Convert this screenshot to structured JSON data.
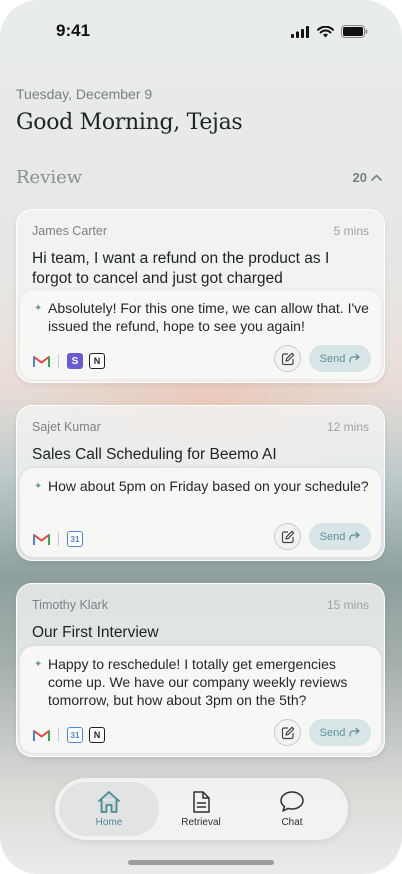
{
  "status": {
    "time": "9:41"
  },
  "header": {
    "date": "Tuesday, December 9",
    "greeting": "Good Morning, Tejas"
  },
  "review": {
    "title": "Review",
    "count": "20"
  },
  "cards": [
    {
      "sender": "James Carter",
      "time_ago": "5 mins",
      "subject": "Hi team, I want a refund on the product as I forgot to cancel and just got charged",
      "reply": "Absolutely! For this one time, we can allow that. I've issued the refund, hope to see you again!",
      "apps": [
        "gmail-icon",
        "stripe-icon",
        "notion-icon"
      ],
      "send_label": "Send"
    },
    {
      "sender": "Sajet Kumar",
      "time_ago": "12 mins",
      "subject": "Sales Call Scheduling for Beemo AI",
      "reply": "How about 5pm on Friday based on your schedule?",
      "apps": [
        "gmail-icon",
        "google-calendar-icon"
      ],
      "send_label": "Send"
    },
    {
      "sender": "Timothy Klark",
      "time_ago": "15 mins",
      "subject": "Our First Interview",
      "reply": "Happy to reschedule! I totally get emergencies come up. We have our company weekly reviews tomorrow, but how about 3pm on the 5th?",
      "apps": [
        "gmail-icon",
        "google-calendar-icon",
        "notion-icon"
      ],
      "send_label": "Send"
    }
  ],
  "tabs": [
    {
      "label": "Home",
      "icon": "home-icon",
      "active": true
    },
    {
      "label": "Retrieval",
      "icon": "document-icon",
      "active": false
    },
    {
      "label": "Chat",
      "icon": "chat-bubble-icon",
      "active": false
    }
  ],
  "colors": {
    "accent": "#4b8996",
    "send_bg": "#d8e5e7"
  }
}
